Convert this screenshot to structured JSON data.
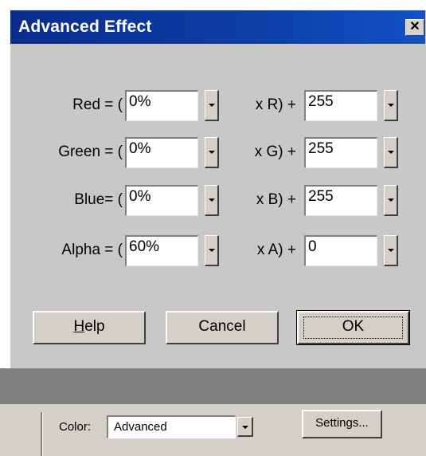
{
  "dialog": {
    "title": "Advanced Effect",
    "close_glyph": "✕",
    "rows": [
      {
        "label": "Red = (",
        "percent": "0%",
        "mult_label": "x R) +",
        "offset": "255"
      },
      {
        "label": "Green = (",
        "percent": "0%",
        "mult_label": "x G) +",
        "offset": "255"
      },
      {
        "label": "Blue= (",
        "percent": "0%",
        "mult_label": "x B) +",
        "offset": "255"
      },
      {
        "label": "Alpha = (",
        "percent": "60%",
        "mult_label": "x A) +",
        "offset": "0"
      }
    ],
    "buttons": {
      "help": "elp",
      "help_mnemonic": "H",
      "cancel": "Cancel",
      "ok": "OK"
    }
  },
  "panel": {
    "color_label": "Color:",
    "color_value": "Advanced",
    "settings_label": "Settings..."
  }
}
